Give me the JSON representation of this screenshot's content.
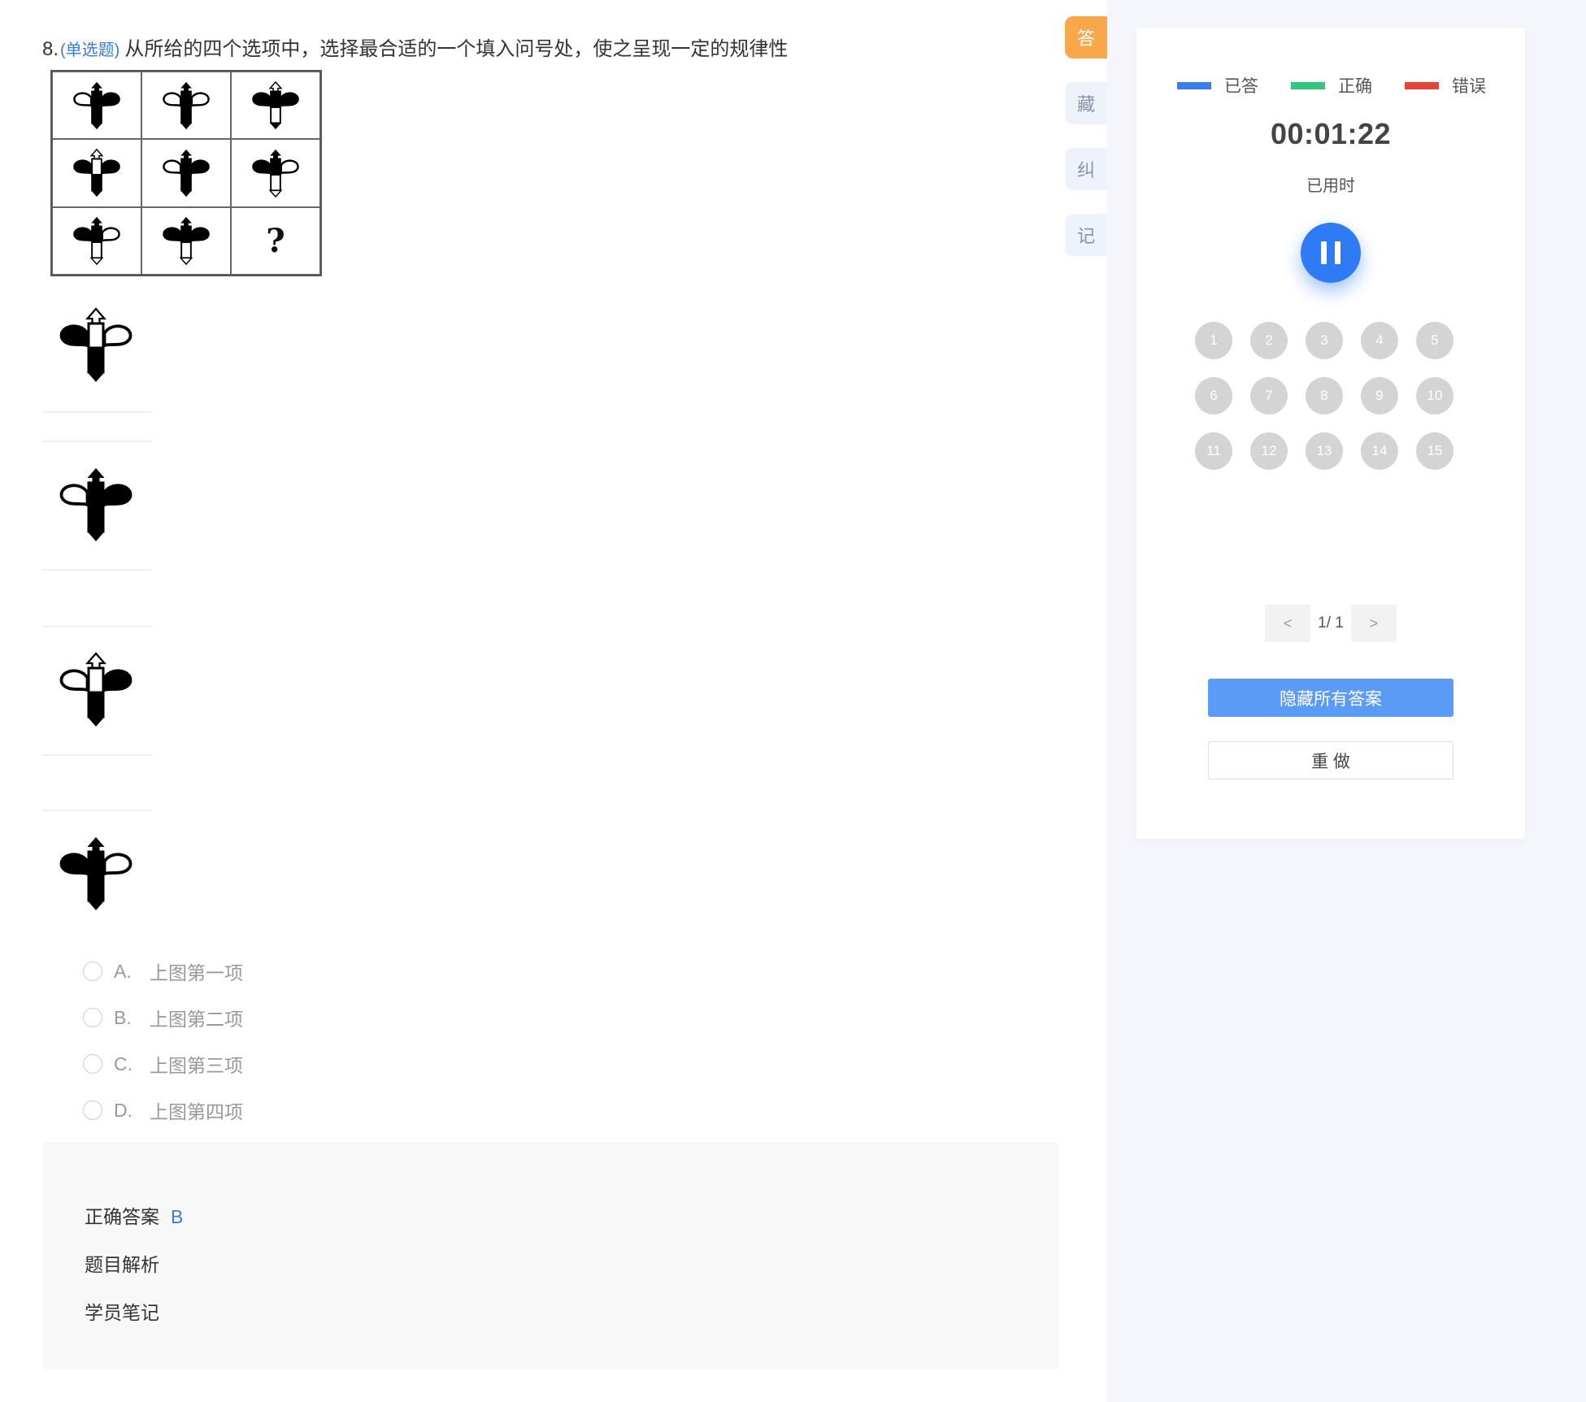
{
  "question": {
    "number": "8.",
    "type_label": "(单选题)",
    "text": "从所给的四个选项中，选择最合适的一个填入问号处，使之呈现一定的规律性",
    "grid_missing_mark": "?",
    "choices": [
      {
        "letter": "A.",
        "text": "上图第一项"
      },
      {
        "letter": "B.",
        "text": "上图第二项"
      },
      {
        "letter": "C.",
        "text": "上图第三项"
      },
      {
        "letter": "D.",
        "text": "上图第四项"
      }
    ]
  },
  "answer_panel": {
    "correct_label": "正确答案",
    "correct_value": "B",
    "analysis_label": "题目解析",
    "notes_label": "学员笔记"
  },
  "side_tabs": [
    {
      "label": "答",
      "active": true
    },
    {
      "label": "藏",
      "active": false
    },
    {
      "label": "纠",
      "active": false
    },
    {
      "label": "记",
      "active": false
    }
  ],
  "sidebar": {
    "legend": [
      {
        "label": "已答",
        "color": "#3b7ded"
      },
      {
        "label": "正确",
        "color": "#33c480"
      },
      {
        "label": "错误",
        "color": "#e5443a"
      }
    ],
    "timer": "00:01:22",
    "timer_label": "已用时",
    "question_numbers": [
      "1",
      "2",
      "3",
      "4",
      "5",
      "6",
      "7",
      "8",
      "9",
      "10",
      "11",
      "12",
      "13",
      "14",
      "15"
    ],
    "pager": {
      "prev": "<",
      "page": "1/ 1",
      "next": ">"
    },
    "hide_answers_button": "隐藏所有答案",
    "redo_button": "重 做"
  },
  "colors": {
    "accent_orange": "#f8a84a",
    "primary_blue": "#2f7bf5",
    "button_blue": "#5b9bf8",
    "link_blue": "#3a7bd5"
  }
}
